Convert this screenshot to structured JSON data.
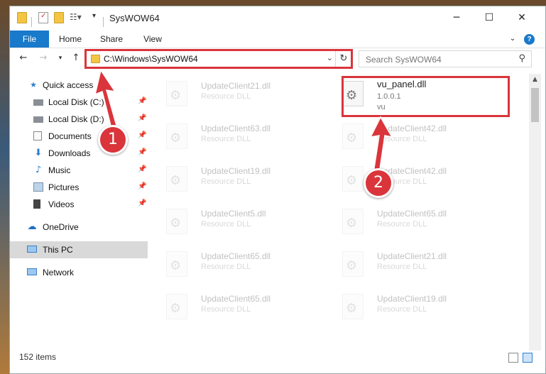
{
  "window": {
    "title": "SysWOW64"
  },
  "ribbon": {
    "tabs": [
      "File",
      "Home",
      "Share",
      "View"
    ]
  },
  "address": {
    "path": "C:\\Windows\\SysWOW64"
  },
  "search": {
    "placeholder": "Search SysWOW64"
  },
  "sidebar": {
    "items": [
      {
        "label": "Quick access",
        "icon": "star-icon"
      },
      {
        "label": "Local Disk (C:)",
        "icon": "drive-icon"
      },
      {
        "label": "Local Disk (D:)",
        "icon": "drive-icon"
      },
      {
        "label": "Documents",
        "icon": "documents-icon"
      },
      {
        "label": "Downloads",
        "icon": "download-arrow-icon"
      },
      {
        "label": "Music",
        "icon": "music-note-icon"
      },
      {
        "label": "Pictures",
        "icon": "pictures-icon"
      },
      {
        "label": "Videos",
        "icon": "film-icon"
      },
      {
        "label": "OneDrive",
        "icon": "cloud-icon"
      },
      {
        "label": "This PC",
        "icon": "monitor-icon"
      },
      {
        "label": "Network",
        "icon": "network-icon"
      }
    ]
  },
  "files": {
    "left": [
      {
        "name": "UpdateClient21.dll",
        "type": "Resource DLL"
      },
      {
        "name": "UpdateClient63.dll",
        "type": "Resource DLL"
      },
      {
        "name": "UpdateClient19.dll",
        "type": "Resource DLL"
      },
      {
        "name": "UpdateClient5.dll",
        "type": "Resource DLL"
      },
      {
        "name": "UpdateClient65.dll",
        "type": "Resource DLL"
      },
      {
        "name": "UpdateClient65.dll",
        "type": "Resource DLL"
      }
    ],
    "right_highlight": {
      "name": "vu_panel.dll",
      "version": "1.0.0.1",
      "company": "vu"
    },
    "right": [
      {
        "name": "UpdateClient42.dll",
        "type": "Resource DLL"
      },
      {
        "name": "UpdateClient42.dll",
        "type": "Resource DLL"
      },
      {
        "name": "UpdateClient65.dll",
        "type": "Resource DLL"
      },
      {
        "name": "UpdateClient21.dll",
        "type": "Resource DLL"
      },
      {
        "name": "UpdateClient19.dll",
        "type": "Resource DLL"
      }
    ]
  },
  "status": {
    "item_count": "152 items"
  },
  "annotations": {
    "step1": "1",
    "step2": "2",
    "color": "#d9353b"
  }
}
